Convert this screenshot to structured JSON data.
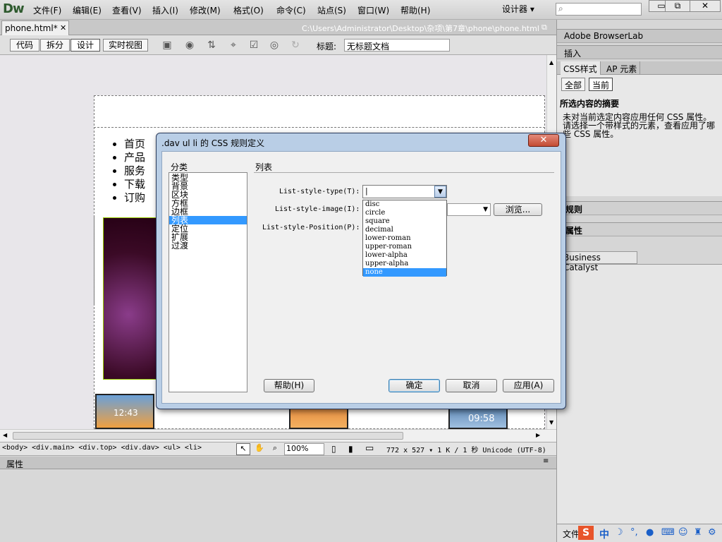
{
  "app": {
    "logo": "Dw"
  },
  "menu": [
    "文件(F)",
    "编辑(E)",
    "查看(V)",
    "插入(I)",
    "修改(M)",
    "格式(O)",
    "命令(C)",
    "站点(S)",
    "窗口(W)",
    "帮助(H)"
  ],
  "workspace": "设计器 ▾",
  "window_controls": {
    "minimize": "▭",
    "restore": "⧉",
    "close": "✕"
  },
  "document": {
    "tab": "phone.html*",
    "tab_close": "✕",
    "path": "C:\\Users\\Administrator\\Desktop\\杂项\\第7章\\phone\\phone.html"
  },
  "toolbar": {
    "views": [
      "代码",
      "拆分",
      "设计",
      "实时视图"
    ],
    "title_label": "标题:",
    "title_value": "无标题文档"
  },
  "page_content": {
    "nav": [
      "首页",
      "产品",
      "服务",
      "下载",
      "订购"
    ],
    "phone_times": [
      "12:43",
      "09:58"
    ]
  },
  "statusbar": {
    "tag_path": "<body> <div.main> <div.top> <div.dav> <ul> <li>",
    "zoom": "100%",
    "dims": "772 x 527 ▾ 1 K / 1 秒 Unicode (UTF-8)"
  },
  "properties": {
    "title": "属性"
  },
  "right_panels": {
    "browserlab": "Adobe BrowserLab",
    "insert": "插入",
    "css_tabs": [
      "CSS样式",
      "AP 元素"
    ],
    "css_modes": [
      "全部",
      "当前"
    ],
    "summary_title": "所选内容的摘要",
    "summary_text": "未对当前选定内容应用任何 CSS 属性。请选择一个带样式的元素，查看应用了哪些 CSS 属性。",
    "rules_title": "规则",
    "props_title": "属性",
    "catalyst": "Business Catalyst",
    "files": "文件"
  },
  "dialog": {
    "title": ".dav ul li 的 CSS 规则定义",
    "close": "✕",
    "category_label": "分类",
    "categories": [
      "类型",
      "背景",
      "区块",
      "方框",
      "边框",
      "列表",
      "定位",
      "扩展",
      "过渡"
    ],
    "selected_category": "列表",
    "section": "列表",
    "fields": {
      "type_label": "List-style-type(T):",
      "image_label": "List-style-image(I):",
      "position_label": "List-style-Position(P):",
      "browse": "浏览..."
    },
    "options": [
      "disc",
      "circle",
      "square",
      "decimal",
      "lower-roman",
      "upper-roman",
      "lower-alpha",
      "upper-alpha",
      "none"
    ],
    "highlighted_option": "none",
    "buttons": {
      "help": "帮助(H)",
      "ok": "确定",
      "cancel": "取消",
      "apply": "应用(A)"
    }
  },
  "colors": {
    "selection": "#3399ff",
    "dialog_frame": "#b9cee6"
  }
}
